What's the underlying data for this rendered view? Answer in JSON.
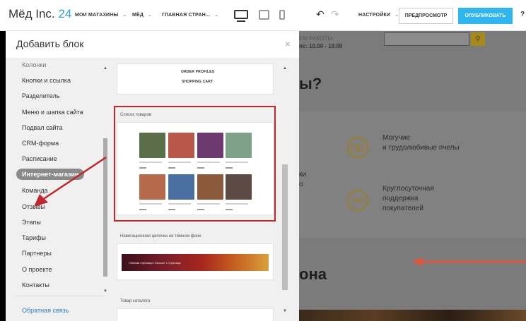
{
  "topbar": {
    "logo_name": "Мёд Inc.",
    "logo_number": "24",
    "nav": [
      "МОИ МАГАЗИНЫ",
      "МЁД",
      "ГЛАВНАЯ СТРАН..."
    ],
    "settings": "НАСТРОЙКИ",
    "preview": "ПРЕДПРОСМОТР",
    "publish": "ОПУБЛИКОВАТЬ",
    "help": "?",
    "undo": "↶",
    "redo": "↷",
    "caret": "⌄"
  },
  "site": {
    "hours_label": "ЕМ РАБОТЫ",
    "hours": "пс: 10.00 - 19.00",
    "search_icon": "⚲",
    "heading1": "ы?",
    "feature1_icon": "bee-icon",
    "feature1_text": [
      "Могучие",
      "и трудолюбивые пчелы"
    ],
    "feature2_icon": "24-7-icon",
    "feature2_badge": "24|7",
    "feature2_text": [
      "Круглосуточная",
      "поддержка",
      "покупателей"
    ],
    "feature_left_fragment": [
      "ки",
      "о"
    ],
    "heading2": "она"
  },
  "panel": {
    "title": "Добавить блок",
    "close": "×",
    "categories": [
      "Колонки",
      "Кнопки и ссылка",
      "Разделитель",
      "Меню и шапка сайта",
      "Подвал сайта",
      "CRM-форма",
      "Расписание",
      "Интернет-магазин",
      "Команда",
      "Отзывы",
      "Этапы",
      "Тарифы",
      "Партнеры",
      "О проекте",
      "Контакты"
    ],
    "active_category": "Интернет-магазин",
    "feedback_link": "Обратная связь",
    "blocks": {
      "order_profiles": "ORDER PROFILES",
      "shopping_cart": "SHOPPING CART",
      "product_list": "Список товаров",
      "breadcrumb_dark": "Навигационная цепочка на тёмном фоне",
      "breadcrumb_text": "Главная страница  •  Каталог  •  Страница",
      "catalog_item": "Товар каталога"
    },
    "product_colors": [
      "#5b6e4a",
      "#b8574a",
      "#6c3a6e",
      "#7fa088",
      "#b66a4c",
      "#4a6fa0",
      "#8a5a3a",
      "#5e4a44"
    ]
  }
}
